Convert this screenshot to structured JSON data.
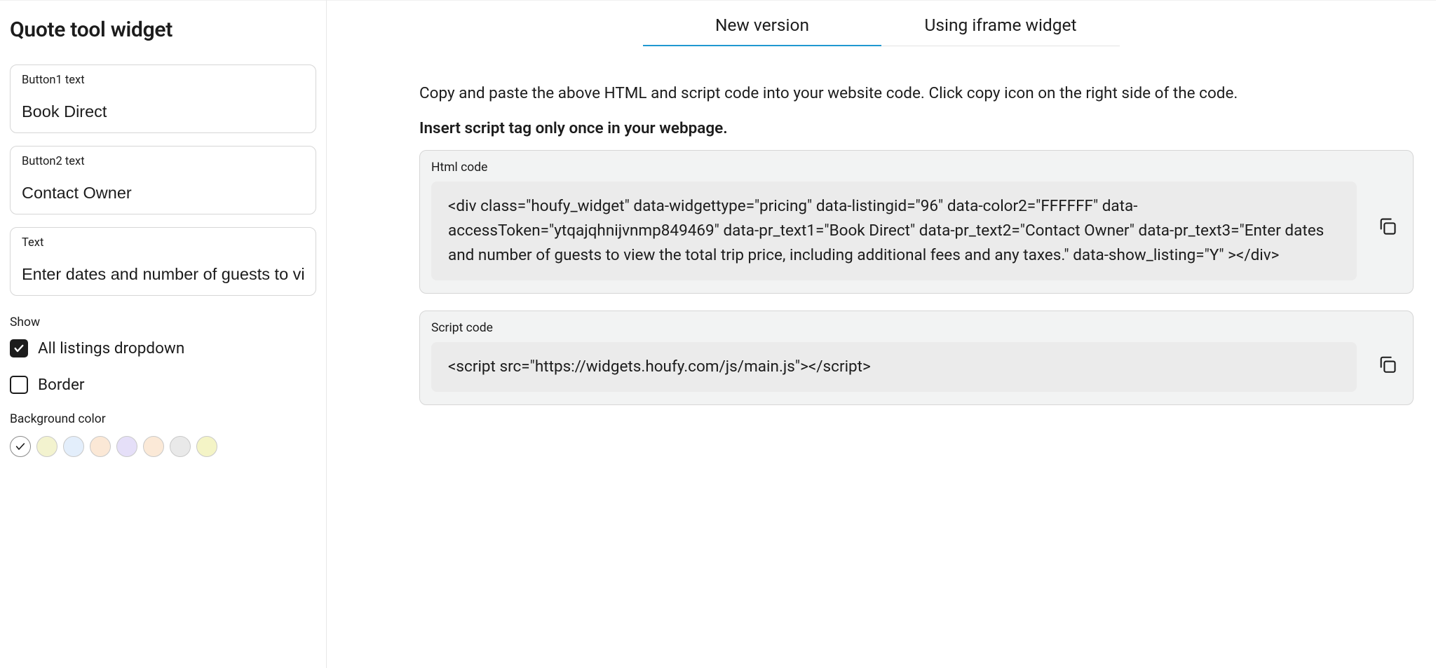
{
  "sidebar": {
    "title": "Quote tool widget",
    "field1": {
      "label": "Button1 text",
      "value": "Book Direct"
    },
    "field2": {
      "label": "Button2 text",
      "value": "Contact Owner"
    },
    "field3": {
      "label": "Text",
      "value": "Enter dates and number of guests to view the total trip price, including additional fees and any taxes."
    },
    "show_label": "Show",
    "checkbox1": {
      "label": "All listings dropdown",
      "checked": true
    },
    "checkbox2": {
      "label": "Border",
      "checked": false
    },
    "bg_label": "Background color",
    "colors": [
      {
        "hex": "#FFFFFF",
        "selected": true
      },
      {
        "hex": "#F3F3CF",
        "selected": false
      },
      {
        "hex": "#E3EEFB",
        "selected": false
      },
      {
        "hex": "#FBE8D6",
        "selected": false
      },
      {
        "hex": "#E5DFF8",
        "selected": false
      },
      {
        "hex": "#FBE9D7",
        "selected": false
      },
      {
        "hex": "#E9E9E9",
        "selected": false
      },
      {
        "hex": "#F4F4C6",
        "selected": false
      }
    ]
  },
  "main": {
    "tabs": [
      {
        "label": "New version",
        "active": true
      },
      {
        "label": "Using iframe widget",
        "active": false
      }
    ],
    "instructions": "Copy and paste the above HTML and script code into your website code. Click copy icon on the right side of the code.",
    "instructions_bold": "Insert script tag only once in your webpage.",
    "html_code": {
      "label": "Html code",
      "value": "<div class=\"houfy_widget\" data-widgettype=\"pricing\" data-listingid=\"96\" data-color2=\"FFFFFF\" data-accessToken=\"ytqajqhnijvnmp849469\" data-pr_text1=\"Book Direct\" data-pr_text2=\"Contact Owner\" data-pr_text3=\"Enter dates and number of guests to view the total trip price, including additional fees and any taxes.\" data-show_listing=\"Y\" ></div>"
    },
    "script_code": {
      "label": "Script code",
      "value": "<script src=\"https://widgets.houfy.com/js/main.js\"></script>"
    }
  }
}
